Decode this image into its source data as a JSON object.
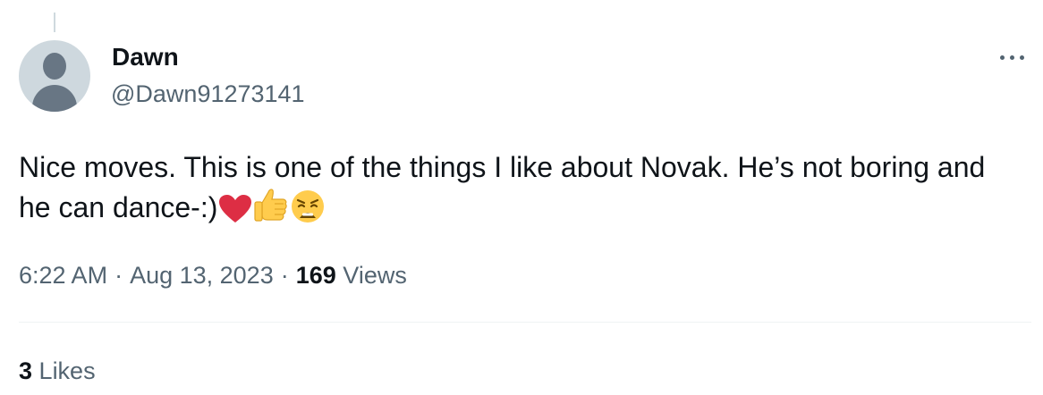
{
  "tweet": {
    "author": {
      "display_name": "Dawn",
      "handle": "@Dawn91273141"
    },
    "text": "Nice moves. This is one of the things I like about Novak. He’s not boring and he can dance-:)",
    "emojis": [
      "red-heart",
      "thumbs-up",
      "weary-face"
    ],
    "time": "6:22 AM",
    "date": "Aug 13, 2023",
    "separator": "·",
    "views_count": "169",
    "views_label": "Views",
    "likes_count": "3",
    "likes_label": "Likes"
  },
  "colors": {
    "text_primary": "#0f1419",
    "text_secondary": "#536471",
    "avatar_bg": "#ced8de",
    "avatar_fg": "#687684",
    "divider": "#eff3f4"
  },
  "icons": [
    "more-options-icon",
    "default-avatar-icon"
  ]
}
